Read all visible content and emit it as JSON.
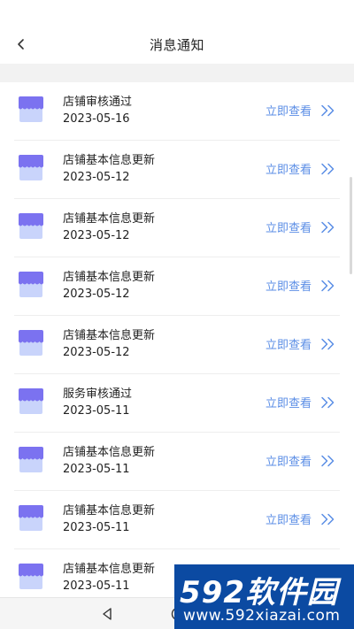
{
  "header": {
    "title": "消息通知",
    "back_icon": "chevron-left-icon"
  },
  "notifications": [
    {
      "title": "店铺审核通过",
      "date": "2023-05-16",
      "action": "立即查看"
    },
    {
      "title": "店铺基本信息更新",
      "date": "2023-05-12",
      "action": "立即查看"
    },
    {
      "title": "店铺基本信息更新",
      "date": "2023-05-12",
      "action": "立即查看"
    },
    {
      "title": "店铺基本信息更新",
      "date": "2023-05-12",
      "action": "立即查看"
    },
    {
      "title": "店铺基本信息更新",
      "date": "2023-05-12",
      "action": "立即查看"
    },
    {
      "title": "服务审核通过",
      "date": "2023-05-11",
      "action": "立即查看"
    },
    {
      "title": "店铺基本信息更新",
      "date": "2023-05-11",
      "action": "立即查看"
    },
    {
      "title": "店铺基本信息更新",
      "date": "2023-05-11",
      "action": "立即查看"
    },
    {
      "title": "店铺基本信息更新",
      "date": "2023-05-11",
      "action": "立即查看"
    }
  ],
  "colors": {
    "accent": "#5b8ee6",
    "icon_awning": "#7b72f0",
    "icon_body": "#c9d4fb",
    "band": "#f2f2f2"
  },
  "navbar": {
    "back_icon": "triangle-back-icon",
    "home_icon": "circle-home-icon"
  },
  "watermark": {
    "logo": "592软件园",
    "url": "www.592xiazai.com"
  }
}
